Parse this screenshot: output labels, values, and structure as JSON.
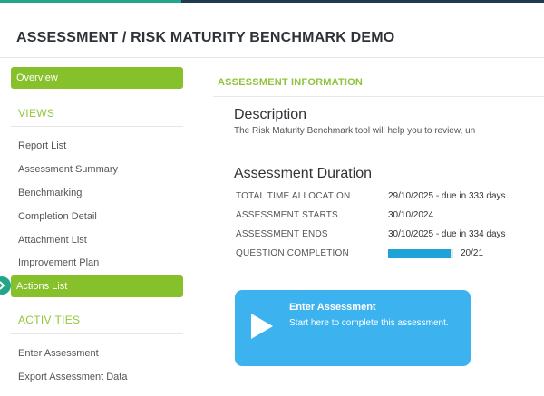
{
  "colors": {
    "accent_green": "#86c02a",
    "section_green": "#92c83a",
    "button_blue": "#3cb2ef",
    "progress_blue": "#1fa2d8",
    "teal": "#23a58a"
  },
  "page": {
    "title": "ASSESSMENT / RISK MATURITY BENCHMARK DEMO"
  },
  "sidebar": {
    "overview_label": "Overview",
    "views_heading": "VIEWS",
    "views": [
      "Report List",
      "Assessment Summary",
      "Benchmarking",
      "Completion Detail",
      "Attachment List",
      "Improvement Plan"
    ],
    "actions_list_label": "Actions List",
    "activities_heading": "ACTIVITIES",
    "activities": [
      "Enter Assessment",
      "Export Assessment Data"
    ]
  },
  "main": {
    "section_title": "ASSESSMENT INFORMATION",
    "description_heading": "Description",
    "description_text": "The Risk Maturity Benchmark tool will help you to review, un",
    "duration_heading": "Assessment Duration",
    "rows": [
      {
        "label": "TOTAL TIME ALLOCATION",
        "value": "29/10/2025 - due in 333 days"
      },
      {
        "label": "ASSESSMENT STARTS",
        "value": "30/10/2024"
      },
      {
        "label": "ASSESSMENT ENDS",
        "value": "30/10/2025 - due in 334 days"
      },
      {
        "label": "QUESTION COMPLETION",
        "value": "20/21"
      }
    ],
    "question_completion_fraction": 0.952
  },
  "enter_button": {
    "title": "Enter Assessment",
    "subtitle": "Start here to complete this assessment.",
    "icon": "play-icon"
  },
  "side_tab_icon": "chevron-right-icon"
}
